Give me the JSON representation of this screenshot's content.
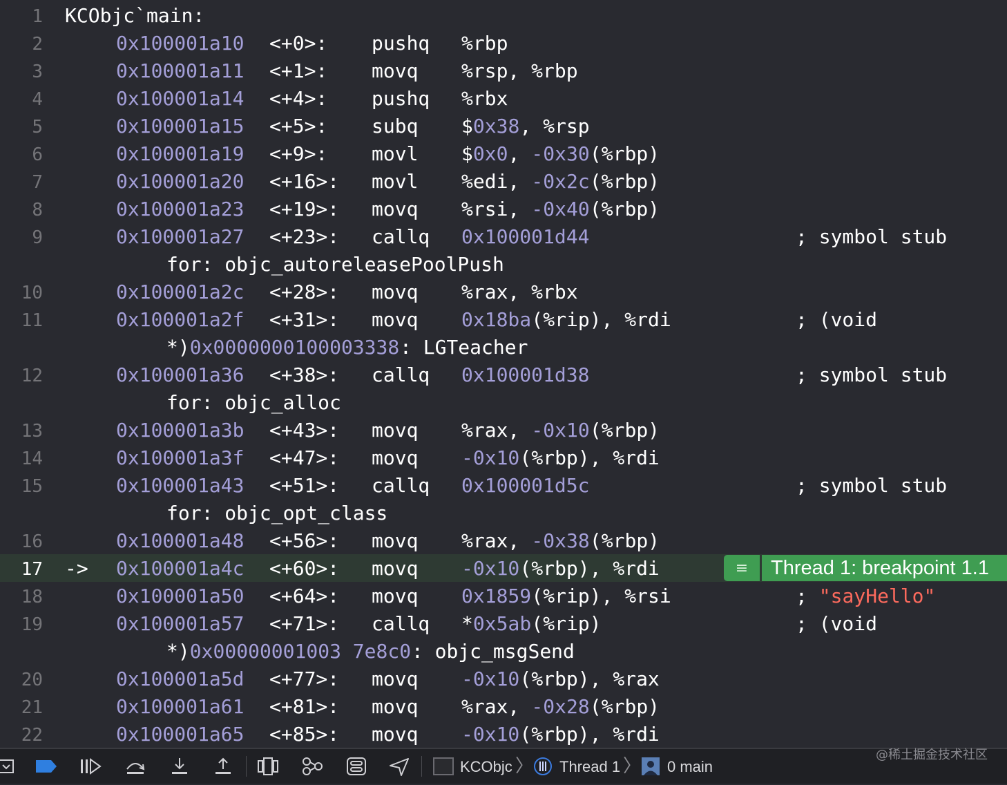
{
  "editor": {
    "current_line": 17,
    "current_arrow": "->",
    "breakpoint_label": "Thread 1: breakpoint 1.1",
    "lines": [
      {
        "n": "1",
        "label": "KCObjc`main:"
      },
      {
        "n": "2",
        "addr": "0x100001a10",
        "off": "<+0>:",
        "op": "pushq",
        "args": [
          [
            "%rbp",
            "p"
          ]
        ]
      },
      {
        "n": "3",
        "addr": "0x100001a11",
        "off": "<+1>:",
        "op": "movq",
        "args": [
          [
            "%rsp, %rbp",
            "p"
          ]
        ]
      },
      {
        "n": "4",
        "addr": "0x100001a14",
        "off": "<+4>:",
        "op": "pushq",
        "args": [
          [
            "%rbx",
            "p"
          ]
        ]
      },
      {
        "n": "5",
        "addr": "0x100001a15",
        "off": "<+5>:",
        "op": "subq",
        "args": [
          [
            "$",
            "p"
          ],
          [
            "0x38",
            "n"
          ],
          [
            ", %rsp",
            "p"
          ]
        ]
      },
      {
        "n": "6",
        "addr": "0x100001a19",
        "off": "<+9>:",
        "op": "movl",
        "args": [
          [
            "$",
            "p"
          ],
          [
            "0x0",
            "n"
          ],
          [
            ", ",
            "p"
          ],
          [
            "-0x30",
            "n"
          ],
          [
            "(%rbp)",
            "p"
          ]
        ]
      },
      {
        "n": "7",
        "addr": "0x100001a20",
        "off": "<+16>:",
        "op": "movl",
        "args": [
          [
            "%edi, ",
            "p"
          ],
          [
            "-0x2c",
            "n"
          ],
          [
            "(%rbp)",
            "p"
          ]
        ]
      },
      {
        "n": "8",
        "addr": "0x100001a23",
        "off": "<+19>:",
        "op": "movq",
        "args": [
          [
            "%rsi, ",
            "p"
          ],
          [
            "-0x40",
            "n"
          ],
          [
            "(%rbp)",
            "p"
          ]
        ]
      },
      {
        "n": "9",
        "addr": "0x100001a27",
        "off": "<+23>:",
        "op": "callq",
        "args": [
          [
            "0x100001d44",
            "n"
          ]
        ],
        "comment": [
          [
            "; symbol stub",
            "p"
          ]
        ]
      },
      {
        "n": "",
        "cont": [
          [
            "for: objc_autoreleasePoolPush",
            "p"
          ]
        ]
      },
      {
        "n": "10",
        "addr": "0x100001a2c",
        "off": "<+28>:",
        "op": "movq",
        "args": [
          [
            "%rax, %rbx",
            "p"
          ]
        ]
      },
      {
        "n": "11",
        "addr": "0x100001a2f",
        "off": "<+31>:",
        "op": "movq",
        "args": [
          [
            "0x18ba",
            "n"
          ],
          [
            "(%rip), %rdi",
            "p"
          ]
        ],
        "comment": [
          [
            "; (void",
            "p"
          ]
        ]
      },
      {
        "n": "",
        "cont": [
          [
            "*)",
            "p"
          ],
          [
            "0x0000000100003338",
            "n"
          ],
          [
            ": LGTeacher",
            "p"
          ]
        ]
      },
      {
        "n": "12",
        "addr": "0x100001a36",
        "off": "<+38>:",
        "op": "callq",
        "args": [
          [
            "0x100001d38",
            "n"
          ]
        ],
        "comment": [
          [
            "; symbol stub",
            "p"
          ]
        ]
      },
      {
        "n": "",
        "cont": [
          [
            "for: objc_alloc",
            "p"
          ]
        ]
      },
      {
        "n": "13",
        "addr": "0x100001a3b",
        "off": "<+43>:",
        "op": "movq",
        "args": [
          [
            "%rax, ",
            "p"
          ],
          [
            "-0x10",
            "n"
          ],
          [
            "(%rbp)",
            "p"
          ]
        ]
      },
      {
        "n": "14",
        "addr": "0x100001a3f",
        "off": "<+47>:",
        "op": "movq",
        "args": [
          [
            "-0x10",
            "n"
          ],
          [
            "(%rbp), %rdi",
            "p"
          ]
        ]
      },
      {
        "n": "15",
        "addr": "0x100001a43",
        "off": "<+51>:",
        "op": "callq",
        "args": [
          [
            "0x100001d5c",
            "n"
          ]
        ],
        "comment": [
          [
            "; symbol stub",
            "p"
          ]
        ]
      },
      {
        "n": "",
        "cont": [
          [
            "for: objc_opt_class",
            "p"
          ]
        ]
      },
      {
        "n": "16",
        "addr": "0x100001a48",
        "off": "<+56>:",
        "op": "movq",
        "args": [
          [
            "%rax, ",
            "p"
          ],
          [
            "-0x38",
            "n"
          ],
          [
            "(%rbp)",
            "p"
          ]
        ]
      },
      {
        "n": "17",
        "addr": "0x100001a4c",
        "off": "<+60>:",
        "op": "movq",
        "args": [
          [
            "-0x10",
            "n"
          ],
          [
            "(%rbp), %rdi",
            "p"
          ]
        ],
        "current": true
      },
      {
        "n": "18",
        "addr": "0x100001a50",
        "off": "<+64>:",
        "op": "movq",
        "args": [
          [
            "0x1859",
            "n"
          ],
          [
            "(%rip), %rsi",
            "p"
          ]
        ],
        "comment": [
          [
            "; ",
            "p"
          ],
          [
            "\"sayHello\"",
            "s"
          ]
        ]
      },
      {
        "n": "19",
        "addr": "0x100001a57",
        "off": "<+71>:",
        "op": "callq",
        "args": [
          [
            "*",
            "p"
          ],
          [
            "0x5ab",
            "n"
          ],
          [
            "(%rip)",
            "p"
          ]
        ],
        "comment": [
          [
            "; (void",
            "p"
          ]
        ]
      },
      {
        "n": "",
        "cont": [
          [
            "*)",
            "p"
          ],
          [
            "0x00000001003 7e8c0",
            "n"
          ],
          [
            ": objc_msgSend",
            "p"
          ]
        ]
      },
      {
        "n": "20",
        "addr": "0x100001a5d",
        "off": "<+77>:",
        "op": "movq",
        "args": [
          [
            "-0x10",
            "n"
          ],
          [
            "(%rbp), %rax",
            "p"
          ]
        ]
      },
      {
        "n": "21",
        "addr": "0x100001a61",
        "off": "<+81>:",
        "op": "movq",
        "args": [
          [
            "%rax, ",
            "p"
          ],
          [
            "-0x28",
            "n"
          ],
          [
            "(%rbp)",
            "p"
          ]
        ]
      },
      {
        "n": "22",
        "addr": "0x100001a65",
        "off": "<+85>:",
        "op": "movq",
        "args": [
          [
            "-0x10",
            "n"
          ],
          [
            "(%rbp), %rdi",
            "p"
          ]
        ]
      }
    ]
  },
  "toolbar": {
    "breadcrumb": {
      "process": "KCObjc",
      "thread": "Thread 1",
      "frame": "0 main"
    },
    "chevron": "〉"
  },
  "watermark": "@稀土掘金技术社区"
}
